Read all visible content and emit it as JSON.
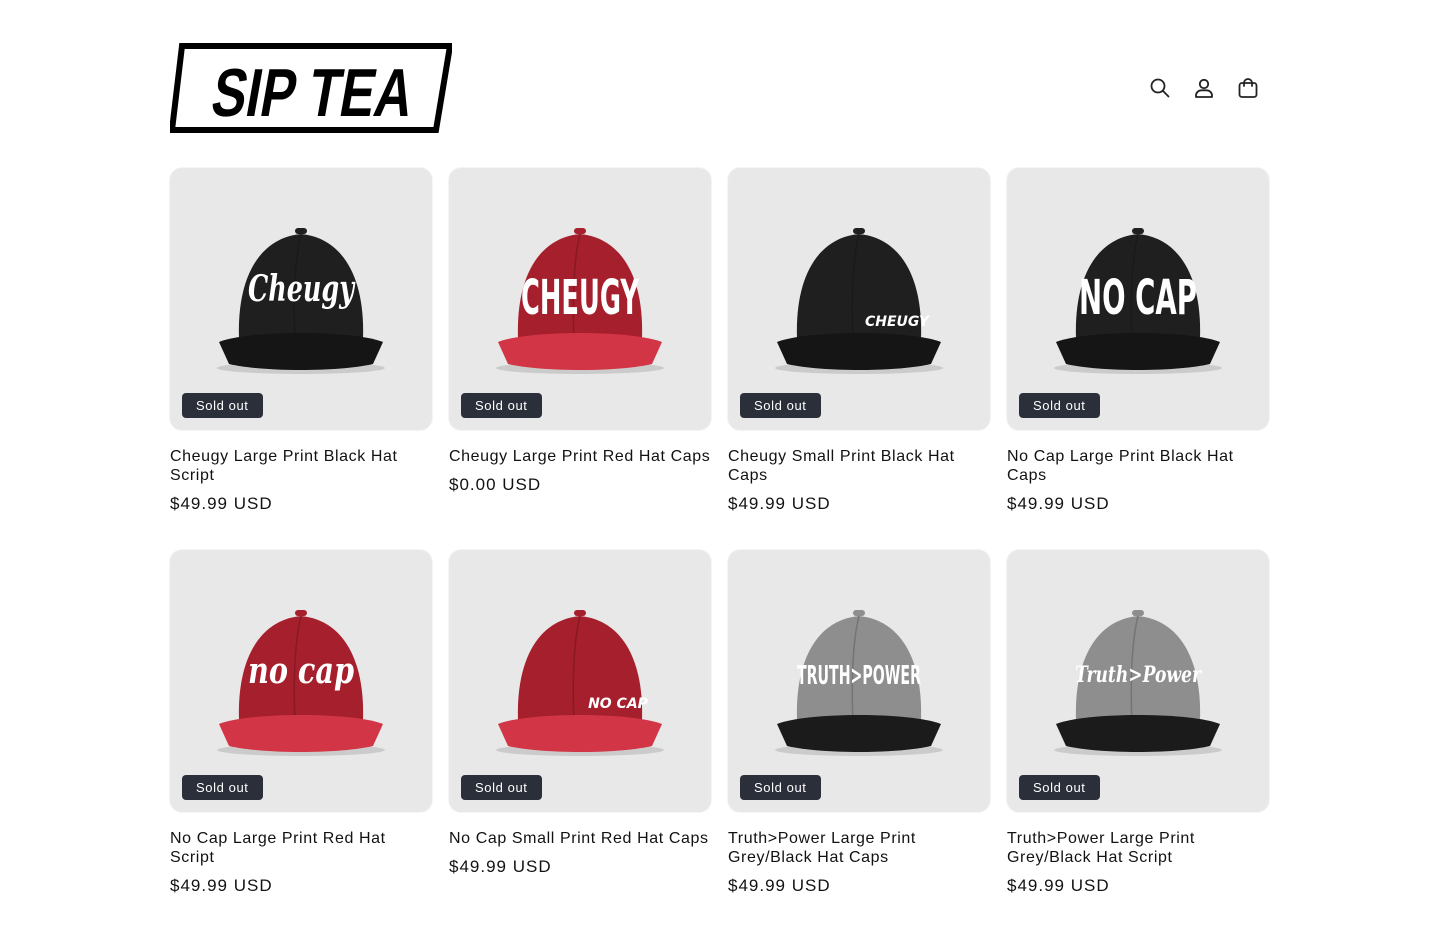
{
  "header": {
    "logo_text": "SIP TEA",
    "icons": [
      "search-icon",
      "account-icon",
      "cart-icon"
    ]
  },
  "products": [
    {
      "title": "Cheugy Large Print Black Hat Script",
      "price": "$49.99 USD",
      "badge": "Sold out",
      "hat": {
        "crown": "#1f1f1f",
        "brim": "#151515",
        "text": "Cheugy",
        "style": "script-large",
        "text_color": "#ffffff"
      }
    },
    {
      "title": "Cheugy Large Print Red Hat Caps",
      "price": "$0.00 USD",
      "badge": "Sold out",
      "hat": {
        "crown": "#a51f2c",
        "brim": "#d23546",
        "text": "CHEUGY",
        "style": "block-large",
        "text_color": "#ffffff"
      }
    },
    {
      "title": "Cheugy Small Print Black Hat Caps",
      "price": "$49.99 USD",
      "badge": "Sold out",
      "hat": {
        "crown": "#1f1f1f",
        "brim": "#151515",
        "text": "CHEUGY",
        "style": "small",
        "text_color": "#ffffff"
      }
    },
    {
      "title": "No Cap Large Print Black Hat Caps",
      "price": "$49.99 USD",
      "badge": "Sold out",
      "hat": {
        "crown": "#1f1f1f",
        "brim": "#151515",
        "text": "NO CAP",
        "style": "block-large",
        "text_color": "#ffffff"
      }
    },
    {
      "title": "No Cap Large Print Red Hat Script",
      "price": "$49.99 USD",
      "badge": "Sold out",
      "hat": {
        "crown": "#a51f2c",
        "brim": "#d23546",
        "text": "no cap",
        "style": "script-large",
        "text_color": "#ffffff"
      }
    },
    {
      "title": "No Cap Small Print Red Hat Caps",
      "price": "$49.99 USD",
      "badge": "Sold out",
      "hat": {
        "crown": "#a51f2c",
        "brim": "#d23546",
        "text": "NO CAP",
        "style": "small",
        "text_color": "#ffffff"
      }
    },
    {
      "title": "Truth>Power Large Print Grey/Black Hat Caps",
      "price": "$49.99 USD",
      "badge": "Sold out",
      "hat": {
        "crown": "#8e8e8e",
        "brim": "#1b1b1b",
        "text": "TRUTH>POWER",
        "style": "block-medium",
        "text_color": "#ffffff"
      }
    },
    {
      "title": "Truth>Power Large Print Grey/Black Hat Script",
      "price": "$49.99 USD",
      "badge": "Sold out",
      "hat": {
        "crown": "#8e8e8e",
        "brim": "#1b1b1b",
        "text": "Truth>Power",
        "style": "script-medium",
        "text_color": "#ffffff"
      }
    }
  ]
}
